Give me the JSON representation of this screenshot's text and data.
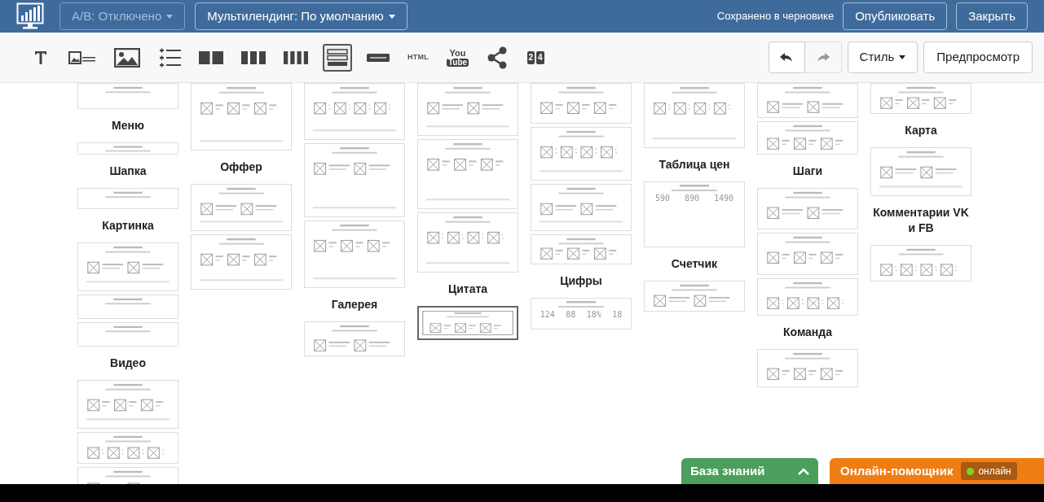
{
  "top_bar": {
    "ab_dropdown": {
      "label": "A/B: Отключено",
      "disabled": true
    },
    "multilanding_dropdown": {
      "label": "Мультилендинг: По умолчанию",
      "disabled": false
    },
    "save_status": "Сохранено в черновике",
    "buttons": [
      "Опубликовать",
      "Закрыть"
    ]
  },
  "toolbar": {
    "tools": [
      {
        "kind": "text-tool",
        "selected": false
      },
      {
        "kind": "image-text",
        "selected": false
      },
      {
        "kind": "image",
        "selected": false
      },
      {
        "kind": "list",
        "selected": false
      },
      {
        "kind": "columns-2",
        "selected": false
      },
      {
        "kind": "columns-3",
        "selected": false
      },
      {
        "kind": "columns-4",
        "selected": false
      },
      {
        "kind": "form",
        "selected": true
      },
      {
        "kind": "divider",
        "selected": false
      },
      {
        "kind": "label",
        "text": "HTML",
        "selected": false
      },
      {
        "kind": "video",
        "top": "You",
        "bottom": "Tube",
        "selected": false
      },
      {
        "kind": "share",
        "selected": false
      },
      {
        "kind": "counter",
        "digits": [
          "2",
          "4"
        ],
        "selected": false
      }
    ],
    "undo_disabled": false,
    "redo_disabled": true,
    "style_button": "Стиль",
    "preview_button": "Предпросмотр"
  },
  "gallery": {
    "columns": [
      [
        {
          "kind": "thumb",
          "selected": false
        },
        {
          "kind": "label",
          "text": "Меню"
        },
        {
          "kind": "thumb",
          "selected": false
        },
        {
          "kind": "label",
          "text": "Шапка"
        },
        {
          "kind": "thumb",
          "selected": false
        },
        {
          "kind": "label",
          "text": "Картинка"
        },
        {
          "kind": "thumb",
          "selected": false
        },
        {
          "kind": "thumb",
          "selected": false
        },
        {
          "kind": "thumb",
          "selected": false
        },
        {
          "kind": "label",
          "text": "Видео"
        },
        {
          "kind": "thumb",
          "selected": false
        },
        {
          "kind": "thumb",
          "selected": false
        },
        {
          "kind": "thumb",
          "selected": false
        }
      ],
      [
        {
          "kind": "thumb",
          "selected": false
        },
        {
          "kind": "label",
          "text": "Оффер"
        },
        {
          "kind": "thumb",
          "selected": false
        },
        {
          "kind": "thumb",
          "selected": false
        }
      ],
      [
        {
          "kind": "thumb",
          "selected": false
        },
        {
          "kind": "thumb",
          "selected": false
        },
        {
          "kind": "thumb",
          "selected": false
        },
        {
          "kind": "label",
          "text": "Галерея"
        },
        {
          "kind": "thumb",
          "selected": false
        }
      ],
      [
        {
          "kind": "thumb",
          "selected": false
        },
        {
          "kind": "thumb",
          "selected": false
        },
        {
          "kind": "thumb",
          "selected": false
        },
        {
          "kind": "label",
          "text": "Цитата"
        },
        {
          "kind": "thumb",
          "selected": true
        }
      ],
      [
        {
          "kind": "thumb",
          "selected": false
        },
        {
          "kind": "thumb",
          "selected": false
        },
        {
          "kind": "thumb",
          "selected": false
        },
        {
          "kind": "thumb",
          "selected": false
        },
        {
          "kind": "label",
          "text": "Цифры"
        },
        {
          "kind": "thumb",
          "selected": false,
          "numbers": [
            "124",
            "88",
            "18%",
            "18"
          ]
        }
      ],
      [
        {
          "kind": "thumb",
          "selected": false
        },
        {
          "kind": "label",
          "text": "Таблица цен"
        },
        {
          "kind": "thumb",
          "selected": false,
          "numbers": [
            "590",
            "890",
            "1490"
          ]
        },
        {
          "kind": "label",
          "text": "Счетчик"
        },
        {
          "kind": "thumb",
          "selected": false
        }
      ],
      [
        {
          "kind": "thumb",
          "selected": false
        },
        {
          "kind": "thumb",
          "selected": false
        },
        {
          "kind": "label",
          "text": "Шаги"
        },
        {
          "kind": "thumb",
          "selected": false
        },
        {
          "kind": "thumb",
          "selected": false
        },
        {
          "kind": "thumb",
          "selected": false
        },
        {
          "kind": "label",
          "text": "Команда"
        },
        {
          "kind": "thumb",
          "selected": false
        }
      ],
      [
        {
          "kind": "thumb",
          "selected": false
        },
        {
          "kind": "label",
          "text": "Карта"
        },
        {
          "kind": "thumb",
          "selected": false
        },
        {
          "kind": "label",
          "text": "Комментарии VK и FB"
        },
        {
          "kind": "thumb",
          "selected": false
        }
      ]
    ]
  },
  "bottom_tabs": {
    "knowledge_base": "База знаний",
    "assistant": "Онлайн-помощник",
    "assistant_status": "онлайн",
    "online": true
  }
}
